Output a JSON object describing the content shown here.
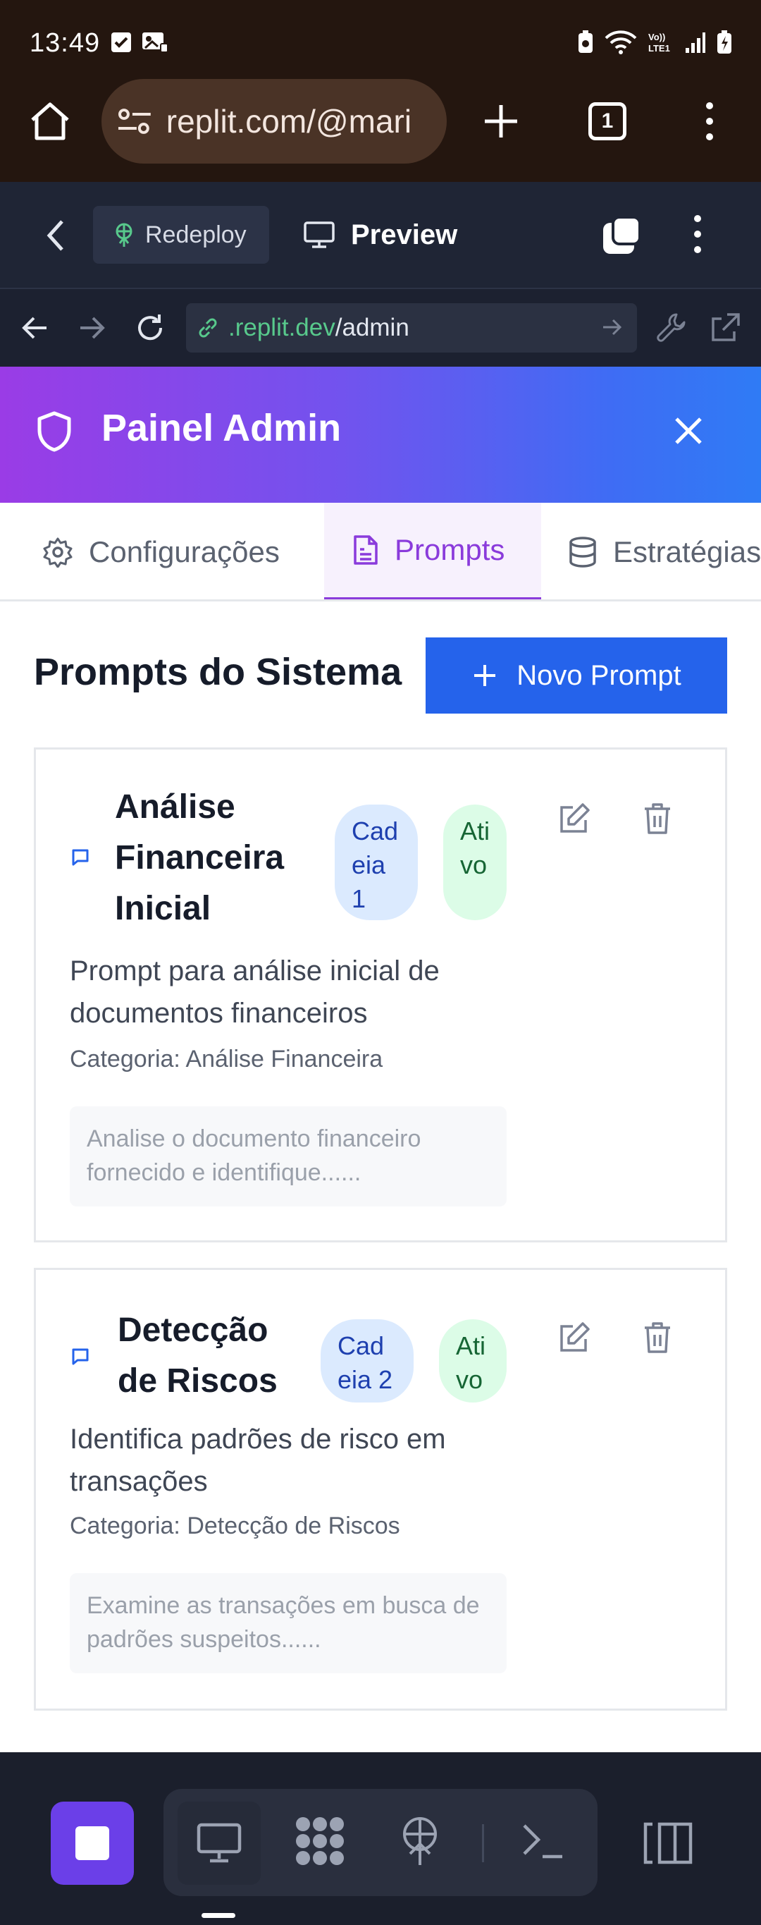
{
  "status_bar": {
    "time": "13:49",
    "left_icons": [
      "check-box-icon",
      "gallery-icon"
    ],
    "right_icons": [
      "battery-saver-icon",
      "wifi-icon",
      "volte-icon",
      "signal-icon",
      "battery-charging-icon"
    ],
    "volte_label": "Vo)) LTE1"
  },
  "browser": {
    "url": "replit.com/@mari",
    "tab_count": "1"
  },
  "replit_bar": {
    "redeploy_label": "Redeploy",
    "preview_label": "Preview"
  },
  "address_bar": {
    "host": ".replit.dev",
    "path": "/admin"
  },
  "admin": {
    "title": "Painel Admin",
    "tabs": [
      {
        "label": "Configurações",
        "icon": "gear-icon"
      },
      {
        "label": "Prompts",
        "icon": "file-text-icon",
        "active": true
      },
      {
        "label": "Estratégias",
        "icon": "database-icon"
      }
    ],
    "section_title": "Prompts do Sistema",
    "new_prompt_label": "Novo Prompt",
    "cards": [
      {
        "title": "Análise Financeira Inicial",
        "chain_badge": "Cadeia 1",
        "status_badge": "Ativo",
        "description": "Prompt para análise inicial de documentos financeiros",
        "category": "Categoria: Análise Financeira",
        "preview": "Analise o documento financeiro fornecido e identifique......"
      },
      {
        "title": "Detecção de Riscos",
        "chain_badge": "Cadeia 2",
        "status_badge": "Ativo",
        "description": "Identifica padrões de risco em transações",
        "category": "Categoria: Detecção de Riscos",
        "preview": "Examine as transações em busca de padrões suspeitos......"
      }
    ]
  },
  "toolbar": {
    "icons": [
      "stop-icon",
      "monitor-icon",
      "packages-icon",
      "deploy-icon",
      "terminal-icon",
      "panels-icon"
    ]
  },
  "colors": {
    "accent_purple": "#8a3bdb",
    "primary_blue": "#2563eb",
    "run_button": "#6b3fe8"
  }
}
